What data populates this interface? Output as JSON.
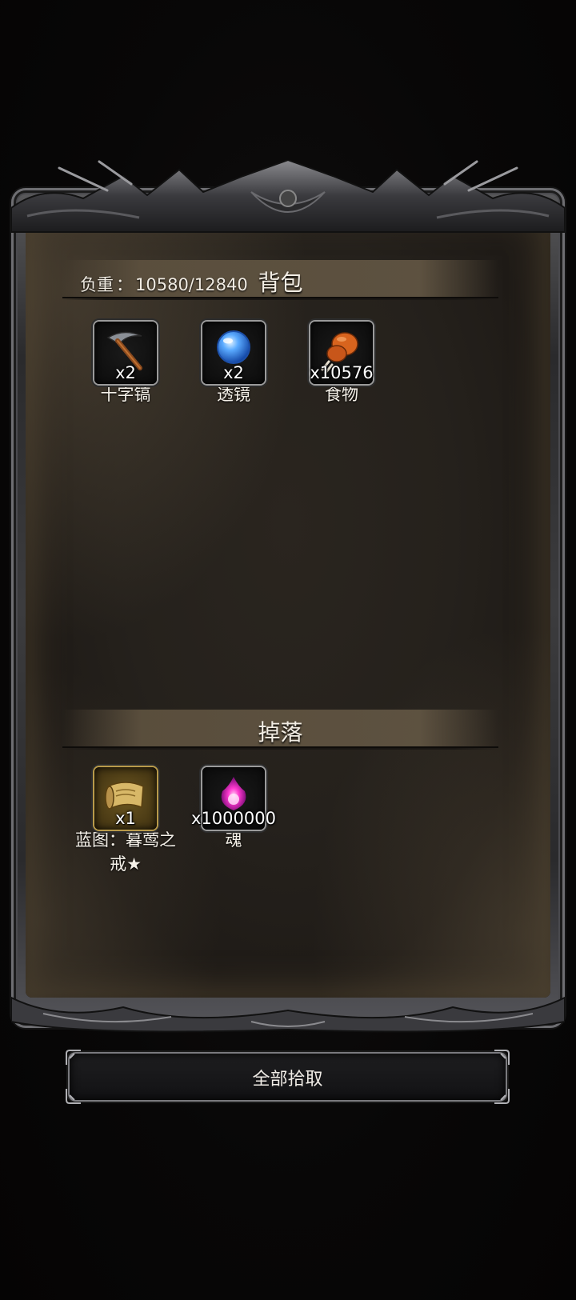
{
  "backpack": {
    "title": "背包",
    "weight_label": "负重",
    "weight_sep": "：",
    "weight_value": "10580/12840",
    "items": [
      {
        "name": "十字镐",
        "qty": "x2",
        "icon": "pickaxe-icon"
      },
      {
        "name": "透镜",
        "qty": "x2",
        "icon": "lens-icon"
      },
      {
        "name": "食物",
        "qty": "x10576",
        "icon": "food-icon"
      }
    ]
  },
  "drops": {
    "title": "掉落",
    "items": [
      {
        "name": "蓝图：暮莺之戒★",
        "qty": "x1",
        "icon": "blueprint-scroll-icon"
      },
      {
        "name": "魂",
        "qty": "x1000000",
        "icon": "soul-flame-icon"
      }
    ]
  },
  "actions": {
    "collect_all": "全部拾取"
  },
  "colors": {
    "background": "#070606",
    "panel": "#25211c",
    "header_band": "#5c503e",
    "text": "#f2ede4",
    "soul_glow": "#ff3ad0",
    "lens_blue": "#3a8cff",
    "food_orange": "#d8641e"
  }
}
